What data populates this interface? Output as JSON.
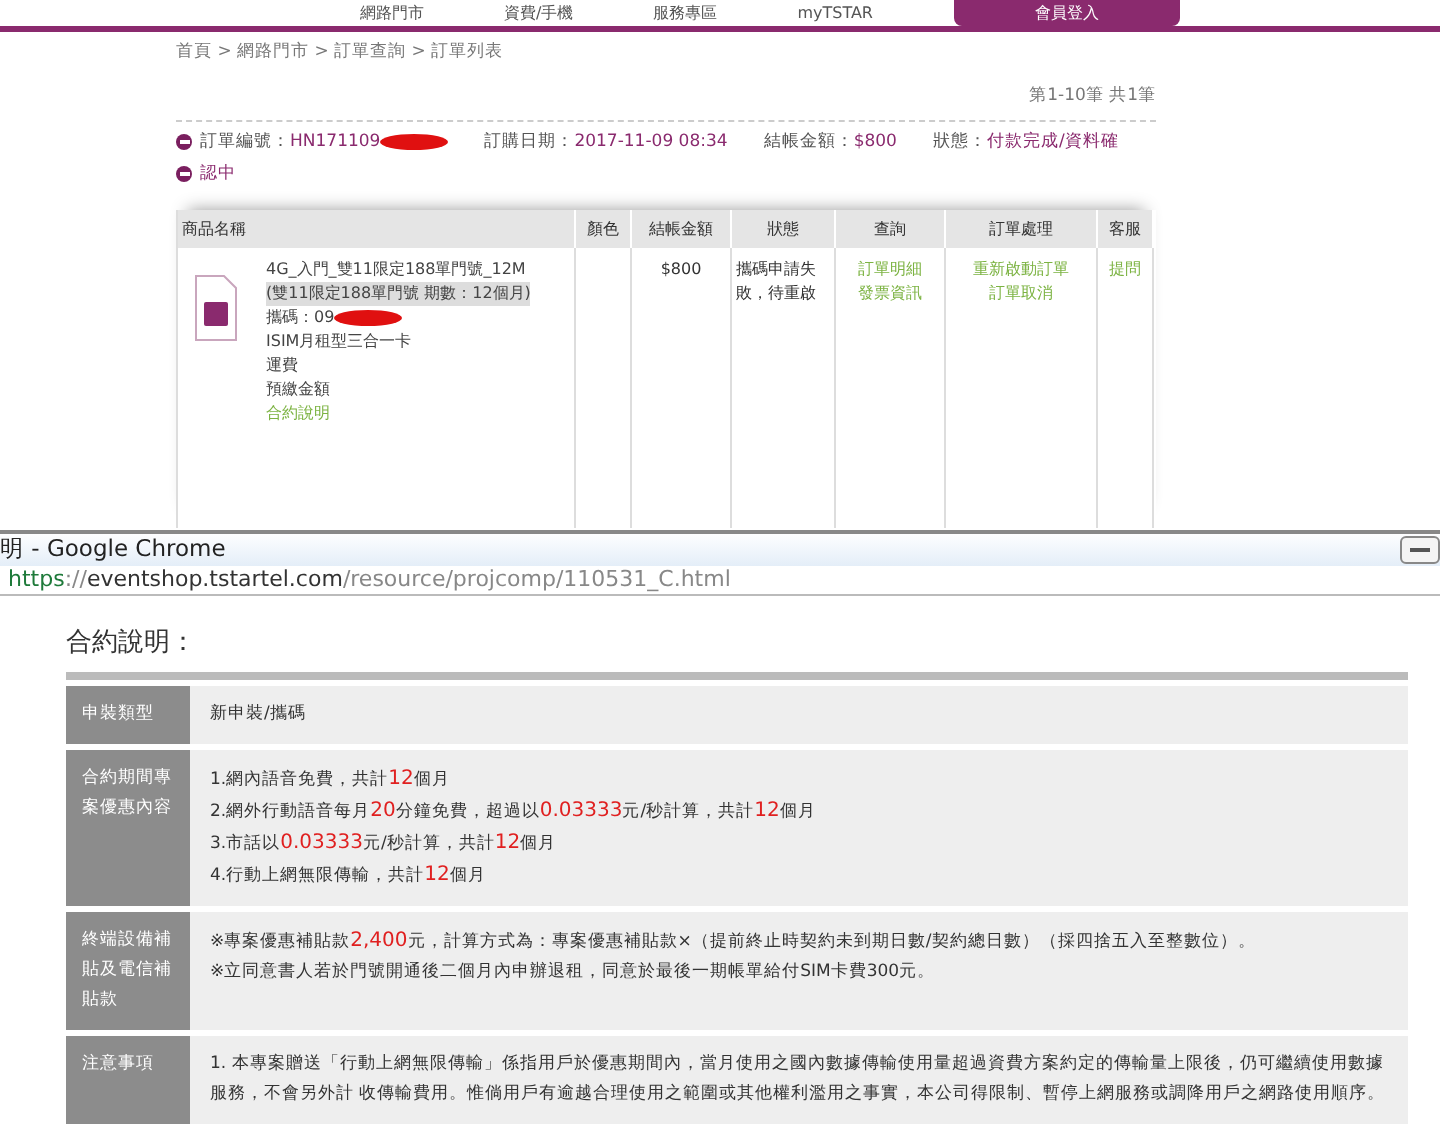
{
  "nav": {
    "items": [
      "網路門市",
      "資費/手機",
      "服務專區",
      "myTSTAR"
    ],
    "login_button": "會員登入"
  },
  "breadcrumb": "首頁 > 網路門市 > 訂單查詢 > 訂單列表",
  "pagination": "第1-10筆 共1筆",
  "order": {
    "number_label": "訂單編號：",
    "number": "HN171109",
    "date_label": "訂購日期：",
    "date": "2017-11-09 08:34",
    "amount_label": "結帳金額：",
    "amount": "$800",
    "status_label": "狀態：",
    "status": "付款完成/資料確",
    "status_cont": "認中"
  },
  "table": {
    "columns": [
      "商品名稱",
      "顏色",
      "結帳金額",
      "狀態",
      "查詢",
      "訂單處理",
      "客服"
    ],
    "rows": [
      {
        "product": {
          "title": "4G_入門_雙11限定188單門號_12M",
          "note": "(雙11限定188單門號 期數：12個月)",
          "number_label": "攜碼：09",
          "items": [
            "ISIM月租型三合一卡",
            "運費",
            "預繳金額"
          ],
          "link": "合約說明"
        },
        "amount": "$800",
        "status": "攜碼申請失敗，待重啟",
        "queries": [
          "訂單明細",
          "發票資訊"
        ],
        "actions": [
          "重新啟動訂單",
          "訂單取消"
        ],
        "service": "提問"
      }
    ]
  },
  "popup": {
    "title": "明 - Google Chrome",
    "url_host": "https://eventshop.tstartel.com",
    "url_path": "/resource/projcomp/110531_C.html",
    "heading": "合約說明：",
    "rows": [
      {
        "label": "申裝類型",
        "lines": [
          [
            {
              "text": "新申裝/攜碼",
              "highlight": false
            }
          ]
        ]
      },
      {
        "label": "合約期間專案優惠內容",
        "lines": [
          [
            {
              "text": "1.網內語音免費，共計",
              "highlight": false
            },
            {
              "text": "12",
              "highlight": true
            },
            {
              "text": "個月",
              "highlight": false
            }
          ],
          [
            {
              "text": "2.網外行動語音每月",
              "highlight": false
            },
            {
              "text": "20",
              "highlight": true
            },
            {
              "text": "分鐘免費，超過以",
              "highlight": false
            },
            {
              "text": "0.03333",
              "highlight": true
            },
            {
              "text": "元/秒計算，共計",
              "highlight": false
            },
            {
              "text": "12",
              "highlight": true
            },
            {
              "text": "個月",
              "highlight": false
            }
          ],
          [
            {
              "text": "3.市話以",
              "highlight": false
            },
            {
              "text": "0.03333",
              "highlight": true
            },
            {
              "text": "元/秒計算，共計",
              "highlight": false
            },
            {
              "text": "12",
              "highlight": true
            },
            {
              "text": "個月",
              "highlight": false
            }
          ],
          [
            {
              "text": "4.行動上網無限傳輸，共計",
              "highlight": false
            },
            {
              "text": "12",
              "highlight": true
            },
            {
              "text": "個月",
              "highlight": false
            }
          ]
        ]
      },
      {
        "label": "終端設備補貼及電信補貼款",
        "lines": [
          [
            {
              "text": "※專案優惠補貼款",
              "highlight": false
            },
            {
              "text": "2,400",
              "highlight": true
            },
            {
              "text": "元，計算方式為：專案優惠補貼款×（提前終止時契約未到期日數/契約總日數）（採四捨五入至整數位）。",
              "highlight": false
            }
          ],
          [
            {
              "text": "※立同意書人若於門號開通後二個月內申辦退租，同意於最後一期帳單給付SIM卡費300元。",
              "highlight": false
            }
          ]
        ]
      },
      {
        "label": "注意事項",
        "lines": [
          [
            {
              "text": "1. 本專案贈送「行動上網無限傳輸」係指用戶於優惠期間內，當月使用之國內數據傳輸使用量超過資費方案約定的傳輸量上限後，仍可繼續使用數據服務，不會另外計 收傳輸費用。惟倘用戶有逾越合理使用之範圍或其他權利濫用之事實，本公司得限制、暫停上網服務或調降用戶之網路使用順序。",
              "highlight": false
            }
          ]
        ]
      }
    ]
  }
}
